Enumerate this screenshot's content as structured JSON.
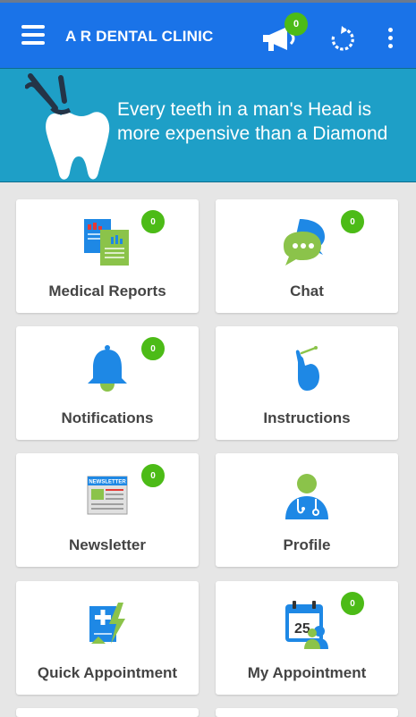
{
  "header": {
    "title": "A R DENTAL CLINIC",
    "announcement_count": "0"
  },
  "banner": {
    "line1": "Every teeth in a man's Head is",
    "line2": "more expensive than a Diamond"
  },
  "tiles": [
    {
      "label": "Medical Reports",
      "badge": "0",
      "icon": "medical-reports-icon"
    },
    {
      "label": "Chat",
      "badge": "0",
      "icon": "chat-icon"
    },
    {
      "label": "Notifications",
      "badge": "0",
      "icon": "bell-icon"
    },
    {
      "label": "Instructions",
      "badge": null,
      "icon": "instructions-icon"
    },
    {
      "label": "Newsletter",
      "badge": "0",
      "icon": "newsletter-icon"
    },
    {
      "label": "Profile",
      "badge": null,
      "icon": "doctor-profile-icon"
    },
    {
      "label": "Quick Appointment",
      "badge": null,
      "icon": "quick-appointment-icon"
    },
    {
      "label": "My Appointment",
      "badge": "0",
      "icon": "calendar-icon"
    }
  ],
  "calendar_day": "25",
  "newsletter_header": "NEWSLETTER",
  "colors": {
    "appbar": "#1a73e8",
    "banner": "#1e9fc7",
    "badge": "#4cbb17",
    "background": "#e6e6e6"
  }
}
